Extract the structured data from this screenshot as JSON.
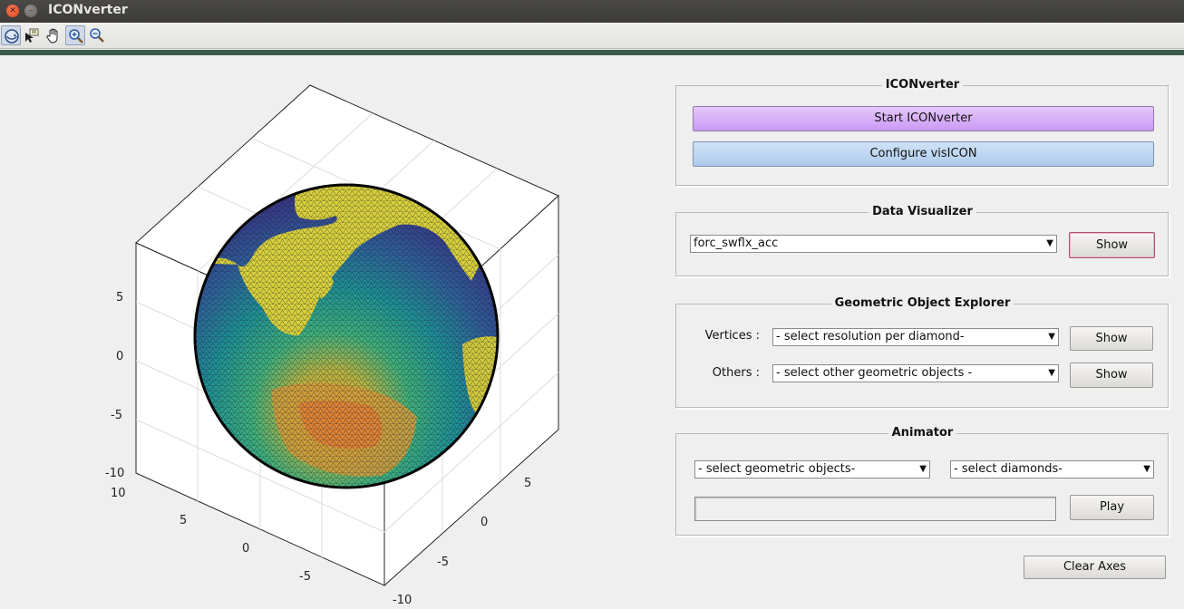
{
  "window": {
    "title": "ICONverter"
  },
  "toolbar": {
    "tools": [
      "rotate-3d",
      "data-cursor",
      "pan",
      "zoom-in",
      "zoom-out"
    ]
  },
  "axes": {
    "z_ticks": [
      "5",
      "0",
      "-5",
      "-10"
    ],
    "x_ticks": [
      "10",
      "5",
      "0",
      "-5"
    ],
    "y_ticks": [
      "5",
      "0",
      "-5",
      "-10"
    ]
  },
  "iconverter": {
    "title": "ICONverter",
    "start_label": "Start ICONverter",
    "configure_label": "Configure visICON"
  },
  "visualizer": {
    "title": "Data Visualizer",
    "selected": "forc_swflx_acc",
    "show_label": "Show"
  },
  "explorer": {
    "title": "Geometric Object Explorer",
    "vertices_label": "Vertices :",
    "vertices_selected": "- select resolution per diamond-",
    "vertices_show": "Show",
    "others_label": "Others :",
    "others_selected": "- select other geometric objects -",
    "others_show": "Show"
  },
  "animator": {
    "title": "Animator",
    "objects_selected": "- select geometric objects-",
    "diamonds_selected": "- select diamonds-",
    "play_label": "Play"
  },
  "clear_axes_label": "Clear Axes"
}
